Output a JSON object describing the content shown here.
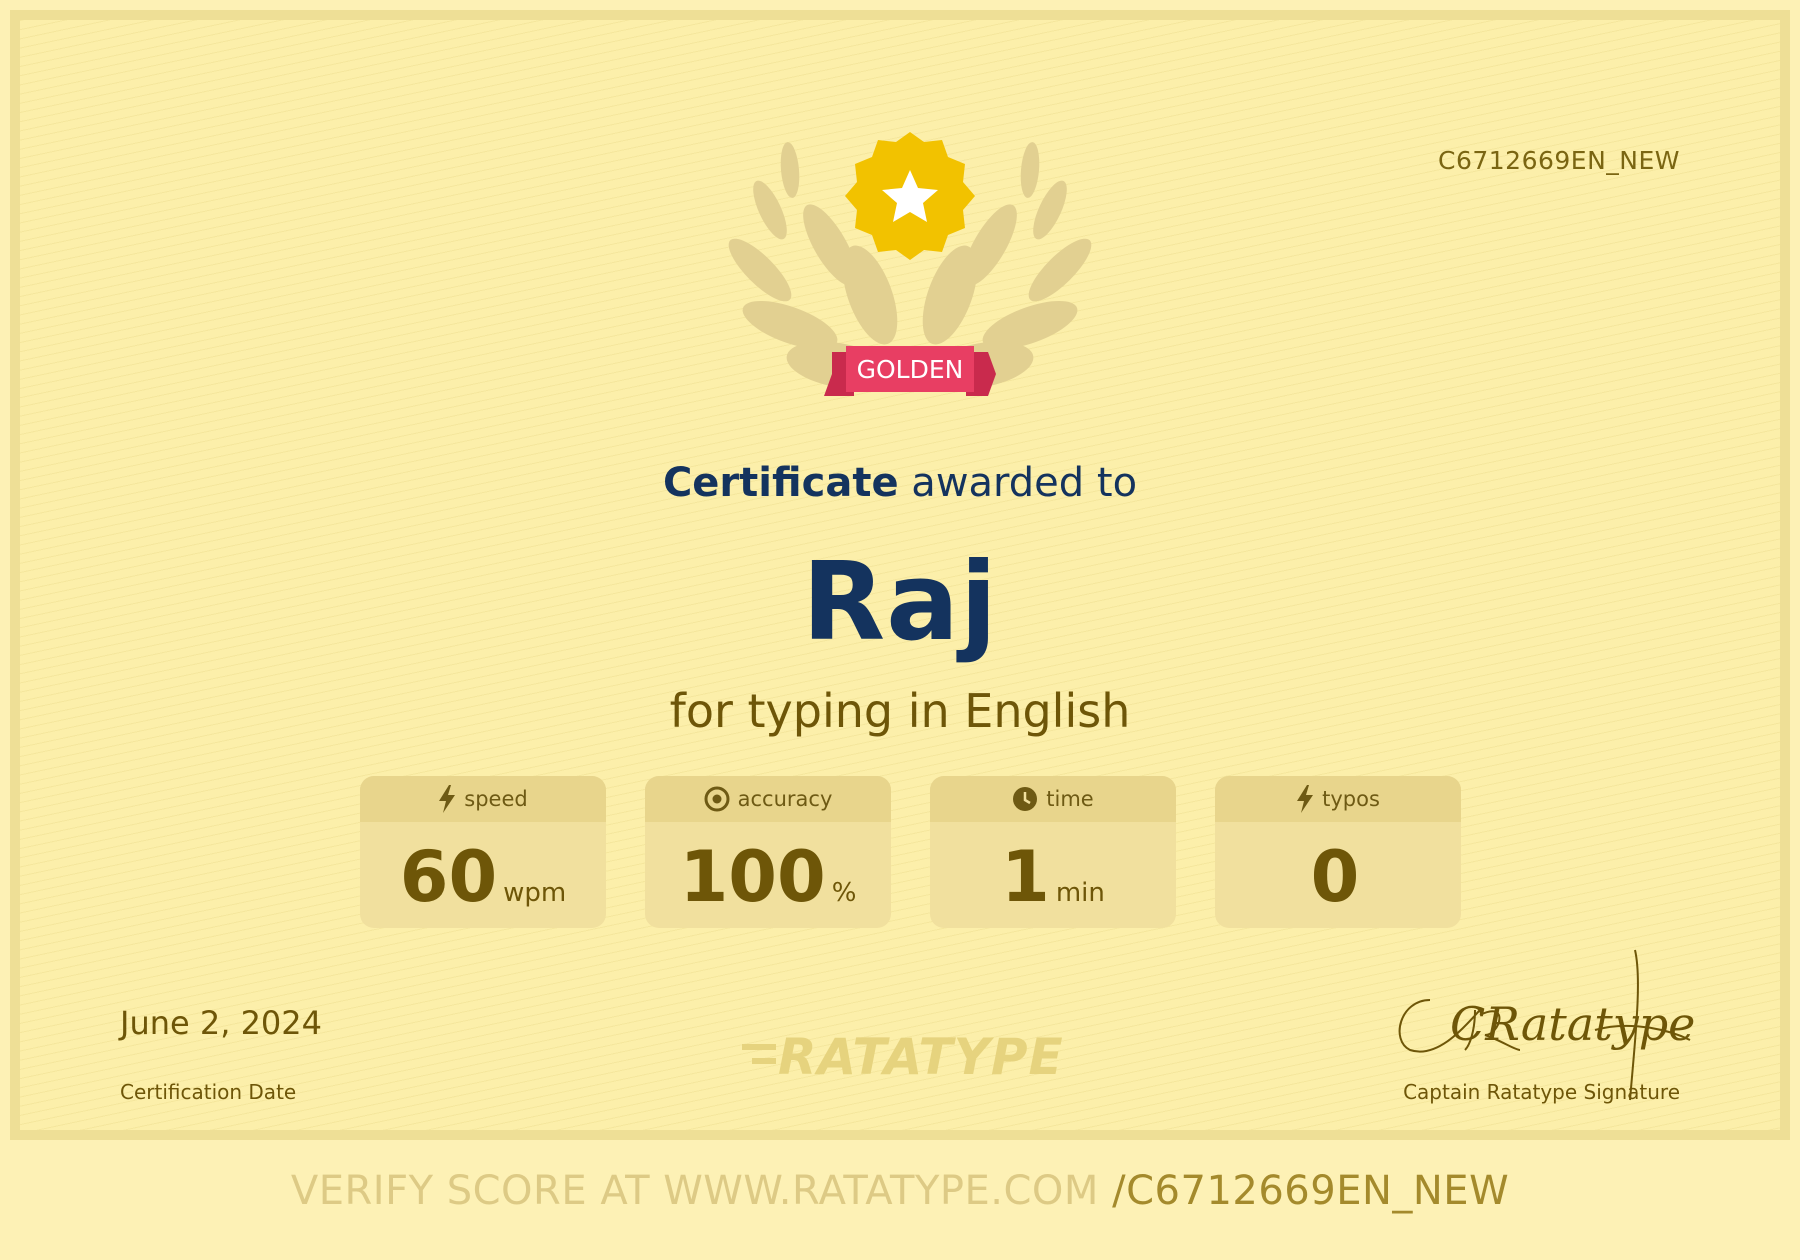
{
  "certificate": {
    "id": "C6712669EN_NEW",
    "level_badge": "GOLDEN",
    "headline_strong": "Certificate",
    "headline_rest": " awarded to",
    "recipient": "Raj",
    "subline": "for typing in English"
  },
  "stats": [
    {
      "label": "speed",
      "icon": "lightning-icon",
      "value": "60",
      "unit": "wpm"
    },
    {
      "label": "accuracy",
      "icon": "target-icon",
      "value": "100",
      "unit": "%"
    },
    {
      "label": "time",
      "icon": "clock-icon",
      "value": "1",
      "unit": "min"
    },
    {
      "label": "typos",
      "icon": "lightning-icon",
      "value": "0",
      "unit": ""
    }
  ],
  "footer": {
    "date": "June 2, 2024",
    "date_label": "Certification Date",
    "brand": "RATATYPE",
    "signature_label": "Captain Ratatype Signature",
    "signature_text": "CRatatype"
  },
  "verify": {
    "lead": "VERIFY SCORE AT WWW.RATATYPE.COM ",
    "code": "/C6712669EN_NEW"
  },
  "colors": {
    "navy": "#14335e",
    "olive": "#6e5608",
    "gold_star": "#f2c200",
    "ribbon": "#e83e63",
    "background": "#fcefaa"
  }
}
